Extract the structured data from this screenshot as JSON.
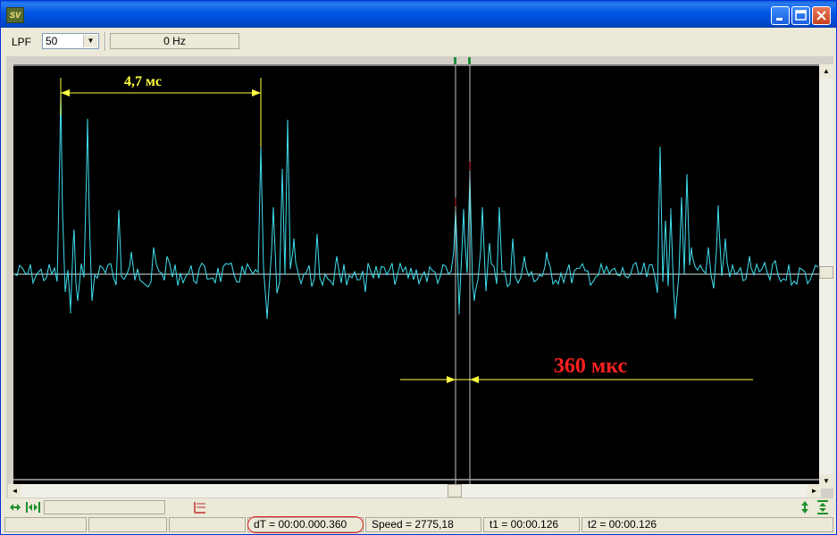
{
  "window": {
    "app_icon_text": "SV",
    "controls": {
      "minimize": "minimize-icon",
      "maximize": "maximize-icon",
      "close": "close-icon"
    }
  },
  "toolbar": {
    "lpf_label": "LPF",
    "lpf_value": "50",
    "frequency": "0 Hz"
  },
  "plot": {
    "background": "#000000",
    "trace_color": "#40e0f0",
    "annotation_color": "#ffff40",
    "label_color": "#ff2020",
    "period_label": "4,7 мс",
    "interval_label": "360 мкс"
  },
  "statusbar": {
    "dt": "dT = 00:00.000.360",
    "speed": "Speed = 2775,18",
    "t1": "t1 = 00:00.126",
    "t2": "t2 = 00:00.126"
  },
  "icons": {
    "fit_horizontal": "fit-horizontal-icon",
    "zoom_horizontal": "zoom-horizontal-icon",
    "chart_settings": "chart-settings-icon",
    "zoom_vertical": "zoom-vertical-icon",
    "fit_vertical": "fit-vertical-icon"
  }
}
